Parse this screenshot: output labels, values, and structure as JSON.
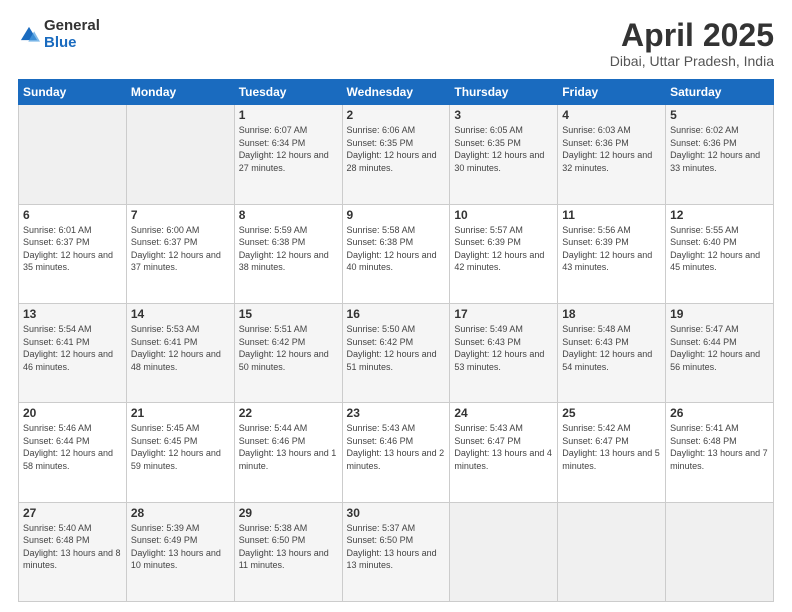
{
  "header": {
    "logo_general": "General",
    "logo_blue": "Blue",
    "month_title": "April 2025",
    "location": "Dibai, Uttar Pradesh, India"
  },
  "days_of_week": [
    "Sunday",
    "Monday",
    "Tuesday",
    "Wednesday",
    "Thursday",
    "Friday",
    "Saturday"
  ],
  "weeks": [
    [
      {
        "num": "",
        "sunrise": "",
        "sunset": "",
        "daylight": ""
      },
      {
        "num": "",
        "sunrise": "",
        "sunset": "",
        "daylight": ""
      },
      {
        "num": "1",
        "sunrise": "Sunrise: 6:07 AM",
        "sunset": "Sunset: 6:34 PM",
        "daylight": "Daylight: 12 hours and 27 minutes."
      },
      {
        "num": "2",
        "sunrise": "Sunrise: 6:06 AM",
        "sunset": "Sunset: 6:35 PM",
        "daylight": "Daylight: 12 hours and 28 minutes."
      },
      {
        "num": "3",
        "sunrise": "Sunrise: 6:05 AM",
        "sunset": "Sunset: 6:35 PM",
        "daylight": "Daylight: 12 hours and 30 minutes."
      },
      {
        "num": "4",
        "sunrise": "Sunrise: 6:03 AM",
        "sunset": "Sunset: 6:36 PM",
        "daylight": "Daylight: 12 hours and 32 minutes."
      },
      {
        "num": "5",
        "sunrise": "Sunrise: 6:02 AM",
        "sunset": "Sunset: 6:36 PM",
        "daylight": "Daylight: 12 hours and 33 minutes."
      }
    ],
    [
      {
        "num": "6",
        "sunrise": "Sunrise: 6:01 AM",
        "sunset": "Sunset: 6:37 PM",
        "daylight": "Daylight: 12 hours and 35 minutes."
      },
      {
        "num": "7",
        "sunrise": "Sunrise: 6:00 AM",
        "sunset": "Sunset: 6:37 PM",
        "daylight": "Daylight: 12 hours and 37 minutes."
      },
      {
        "num": "8",
        "sunrise": "Sunrise: 5:59 AM",
        "sunset": "Sunset: 6:38 PM",
        "daylight": "Daylight: 12 hours and 38 minutes."
      },
      {
        "num": "9",
        "sunrise": "Sunrise: 5:58 AM",
        "sunset": "Sunset: 6:38 PM",
        "daylight": "Daylight: 12 hours and 40 minutes."
      },
      {
        "num": "10",
        "sunrise": "Sunrise: 5:57 AM",
        "sunset": "Sunset: 6:39 PM",
        "daylight": "Daylight: 12 hours and 42 minutes."
      },
      {
        "num": "11",
        "sunrise": "Sunrise: 5:56 AM",
        "sunset": "Sunset: 6:39 PM",
        "daylight": "Daylight: 12 hours and 43 minutes."
      },
      {
        "num": "12",
        "sunrise": "Sunrise: 5:55 AM",
        "sunset": "Sunset: 6:40 PM",
        "daylight": "Daylight: 12 hours and 45 minutes."
      }
    ],
    [
      {
        "num": "13",
        "sunrise": "Sunrise: 5:54 AM",
        "sunset": "Sunset: 6:41 PM",
        "daylight": "Daylight: 12 hours and 46 minutes."
      },
      {
        "num": "14",
        "sunrise": "Sunrise: 5:53 AM",
        "sunset": "Sunset: 6:41 PM",
        "daylight": "Daylight: 12 hours and 48 minutes."
      },
      {
        "num": "15",
        "sunrise": "Sunrise: 5:51 AM",
        "sunset": "Sunset: 6:42 PM",
        "daylight": "Daylight: 12 hours and 50 minutes."
      },
      {
        "num": "16",
        "sunrise": "Sunrise: 5:50 AM",
        "sunset": "Sunset: 6:42 PM",
        "daylight": "Daylight: 12 hours and 51 minutes."
      },
      {
        "num": "17",
        "sunrise": "Sunrise: 5:49 AM",
        "sunset": "Sunset: 6:43 PM",
        "daylight": "Daylight: 12 hours and 53 minutes."
      },
      {
        "num": "18",
        "sunrise": "Sunrise: 5:48 AM",
        "sunset": "Sunset: 6:43 PM",
        "daylight": "Daylight: 12 hours and 54 minutes."
      },
      {
        "num": "19",
        "sunrise": "Sunrise: 5:47 AM",
        "sunset": "Sunset: 6:44 PM",
        "daylight": "Daylight: 12 hours and 56 minutes."
      }
    ],
    [
      {
        "num": "20",
        "sunrise": "Sunrise: 5:46 AM",
        "sunset": "Sunset: 6:44 PM",
        "daylight": "Daylight: 12 hours and 58 minutes."
      },
      {
        "num": "21",
        "sunrise": "Sunrise: 5:45 AM",
        "sunset": "Sunset: 6:45 PM",
        "daylight": "Daylight: 12 hours and 59 minutes."
      },
      {
        "num": "22",
        "sunrise": "Sunrise: 5:44 AM",
        "sunset": "Sunset: 6:46 PM",
        "daylight": "Daylight: 13 hours and 1 minute."
      },
      {
        "num": "23",
        "sunrise": "Sunrise: 5:43 AM",
        "sunset": "Sunset: 6:46 PM",
        "daylight": "Daylight: 13 hours and 2 minutes."
      },
      {
        "num": "24",
        "sunrise": "Sunrise: 5:43 AM",
        "sunset": "Sunset: 6:47 PM",
        "daylight": "Daylight: 13 hours and 4 minutes."
      },
      {
        "num": "25",
        "sunrise": "Sunrise: 5:42 AM",
        "sunset": "Sunset: 6:47 PM",
        "daylight": "Daylight: 13 hours and 5 minutes."
      },
      {
        "num": "26",
        "sunrise": "Sunrise: 5:41 AM",
        "sunset": "Sunset: 6:48 PM",
        "daylight": "Daylight: 13 hours and 7 minutes."
      }
    ],
    [
      {
        "num": "27",
        "sunrise": "Sunrise: 5:40 AM",
        "sunset": "Sunset: 6:48 PM",
        "daylight": "Daylight: 13 hours and 8 minutes."
      },
      {
        "num": "28",
        "sunrise": "Sunrise: 5:39 AM",
        "sunset": "Sunset: 6:49 PM",
        "daylight": "Daylight: 13 hours and 10 minutes."
      },
      {
        "num": "29",
        "sunrise": "Sunrise: 5:38 AM",
        "sunset": "Sunset: 6:50 PM",
        "daylight": "Daylight: 13 hours and 11 minutes."
      },
      {
        "num": "30",
        "sunrise": "Sunrise: 5:37 AM",
        "sunset": "Sunset: 6:50 PM",
        "daylight": "Daylight: 13 hours and 13 minutes."
      },
      {
        "num": "",
        "sunrise": "",
        "sunset": "",
        "daylight": ""
      },
      {
        "num": "",
        "sunrise": "",
        "sunset": "",
        "daylight": ""
      },
      {
        "num": "",
        "sunrise": "",
        "sunset": "",
        "daylight": ""
      }
    ]
  ]
}
